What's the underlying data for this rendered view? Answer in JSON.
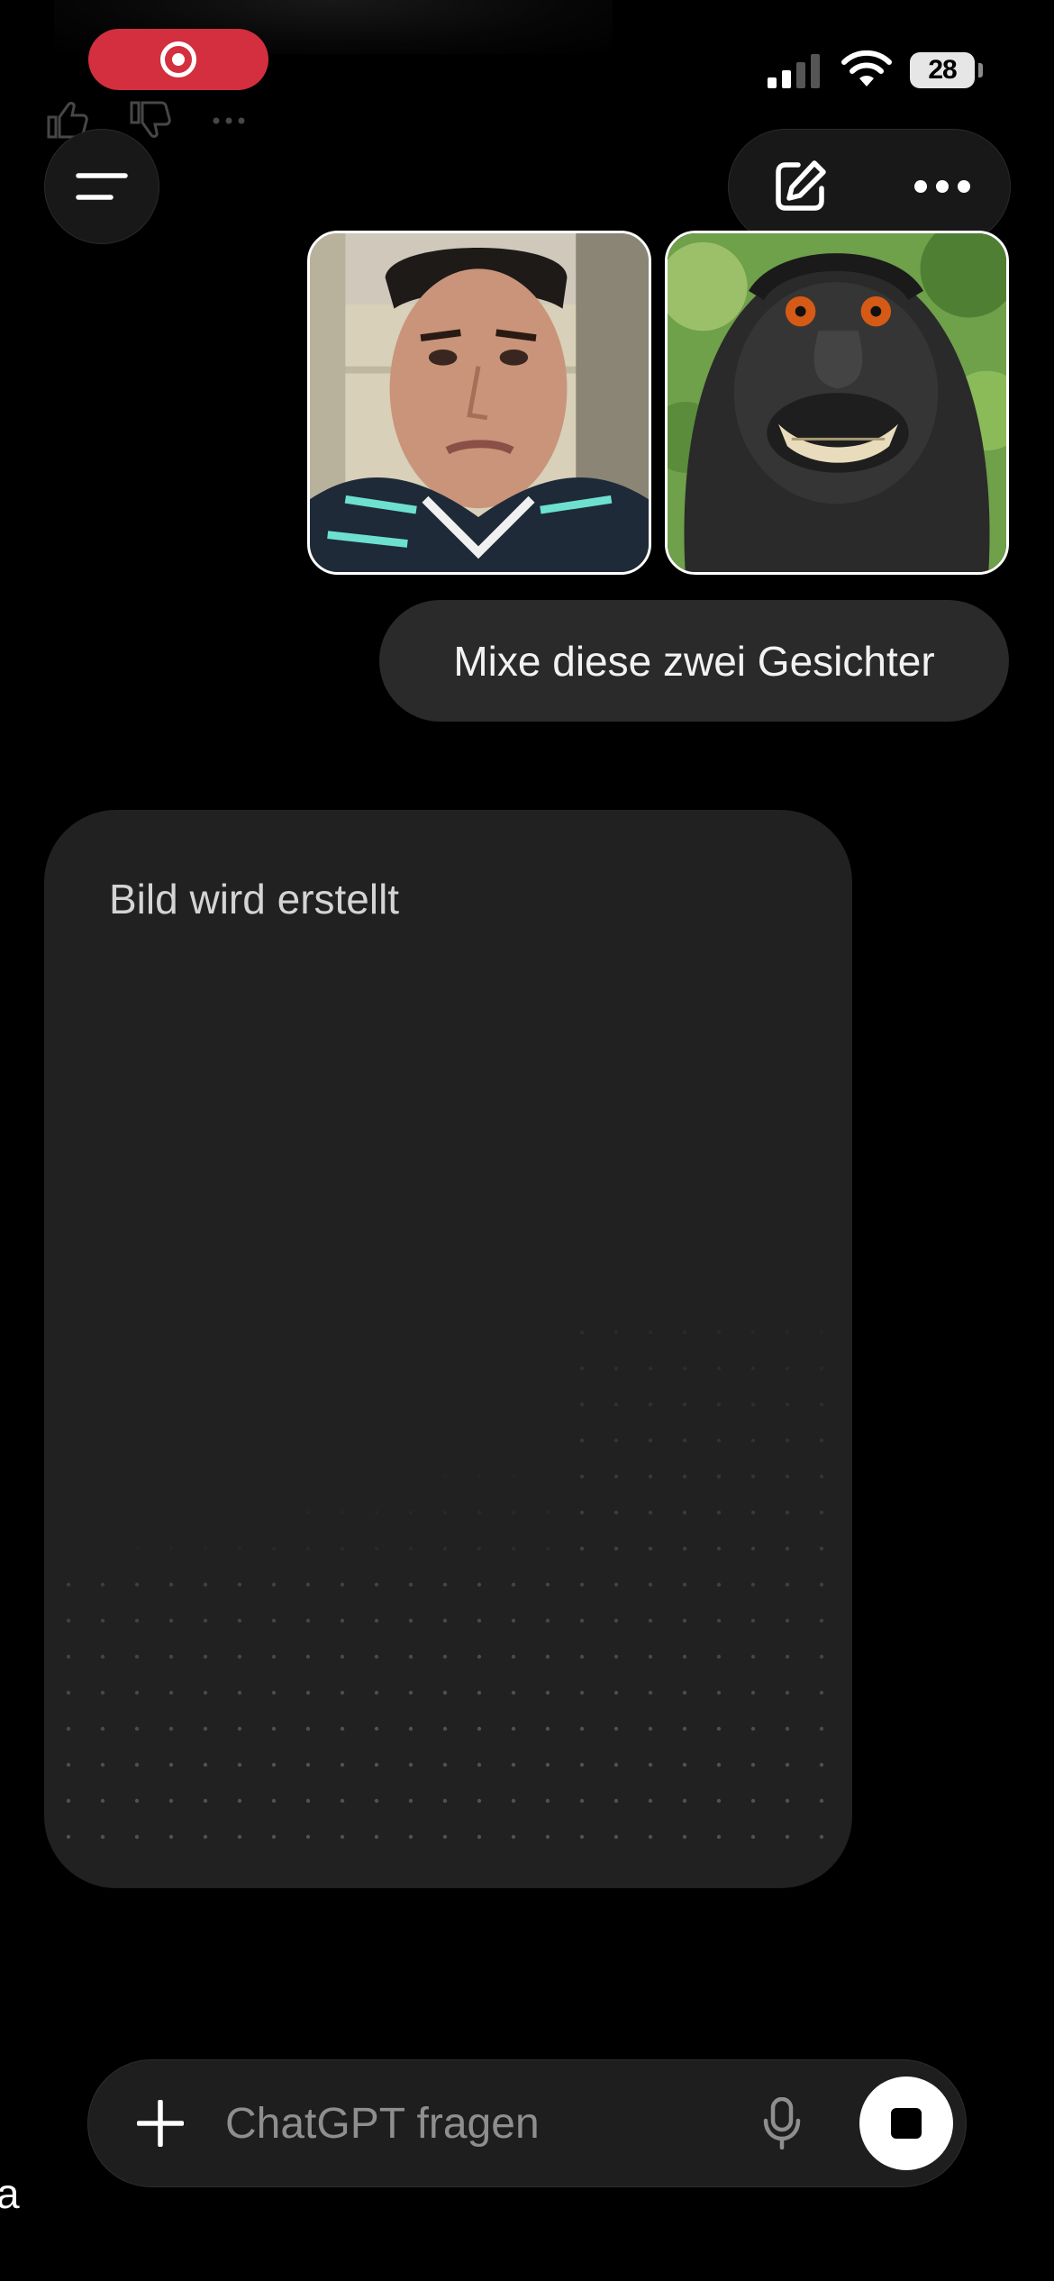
{
  "status_bar": {
    "battery_level": "28",
    "recording_color": "#d32f3f",
    "icons": [
      "record-icon",
      "cellular-signal-icon",
      "wifi-icon",
      "battery-icon"
    ]
  },
  "header": {
    "icons": [
      "menu-icon",
      "edit-icon",
      "more-icon"
    ]
  },
  "conversation": {
    "attachments": [
      {
        "kind": "photo",
        "subject": "man-face"
      },
      {
        "kind": "photo",
        "subject": "monkey-face"
      }
    ],
    "user_message": "Mixe diese zwei Gesichter",
    "assistant_status": "Bild wird erstellt"
  },
  "composer": {
    "placeholder": "ChatGPT fragen",
    "icons": [
      "plus-icon",
      "microphone-icon",
      "stop-icon"
    ]
  },
  "edge_text": "a",
  "colors": {
    "background": "#000000",
    "bubble": "#2a2a2a",
    "card": "#212121",
    "stop_button": "#ffffff"
  }
}
